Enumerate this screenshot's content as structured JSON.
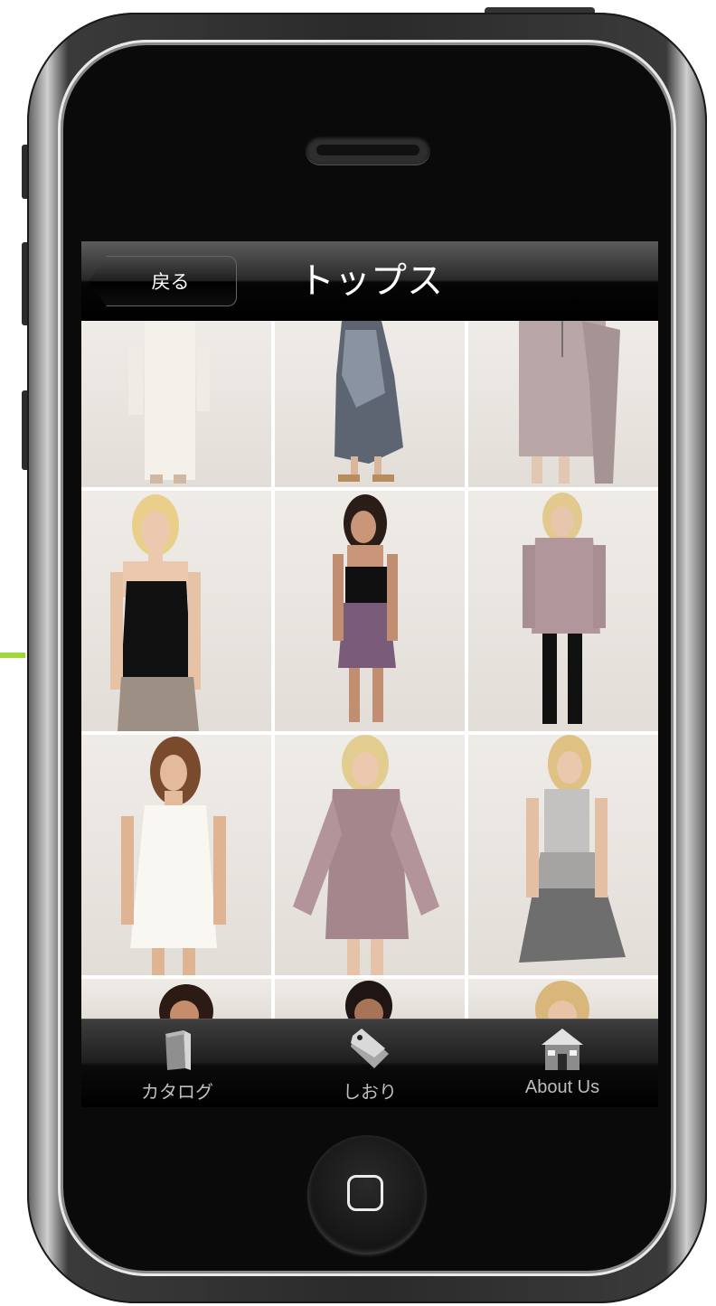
{
  "nav": {
    "back_label": "戻る",
    "title": "トップス"
  },
  "grid": {
    "items": [
      {
        "name": "product-white-dress"
      },
      {
        "name": "product-print-maxi-dress"
      },
      {
        "name": "product-mauve-drape-dress"
      },
      {
        "name": "product-black-cami-top"
      },
      {
        "name": "product-black-bandeau-print-shorts"
      },
      {
        "name": "product-plaid-tunic-shirt"
      },
      {
        "name": "product-white-shift-dress"
      },
      {
        "name": "product-print-bell-sleeve-dress"
      },
      {
        "name": "product-ombre-tank-dress"
      },
      {
        "name": "product-partial-1"
      },
      {
        "name": "product-partial-2"
      },
      {
        "name": "product-partial-3"
      }
    ]
  },
  "tabbar": {
    "tabs": [
      {
        "label": "カタログ",
        "icon": "book-icon"
      },
      {
        "label": "しおり",
        "icon": "tag-icon"
      },
      {
        "label": "About Us",
        "icon": "house-icon"
      }
    ]
  },
  "colors": {
    "accent": "#9fd83a",
    "screen_background": "#000000",
    "tab_label": "#bdbdbd"
  }
}
